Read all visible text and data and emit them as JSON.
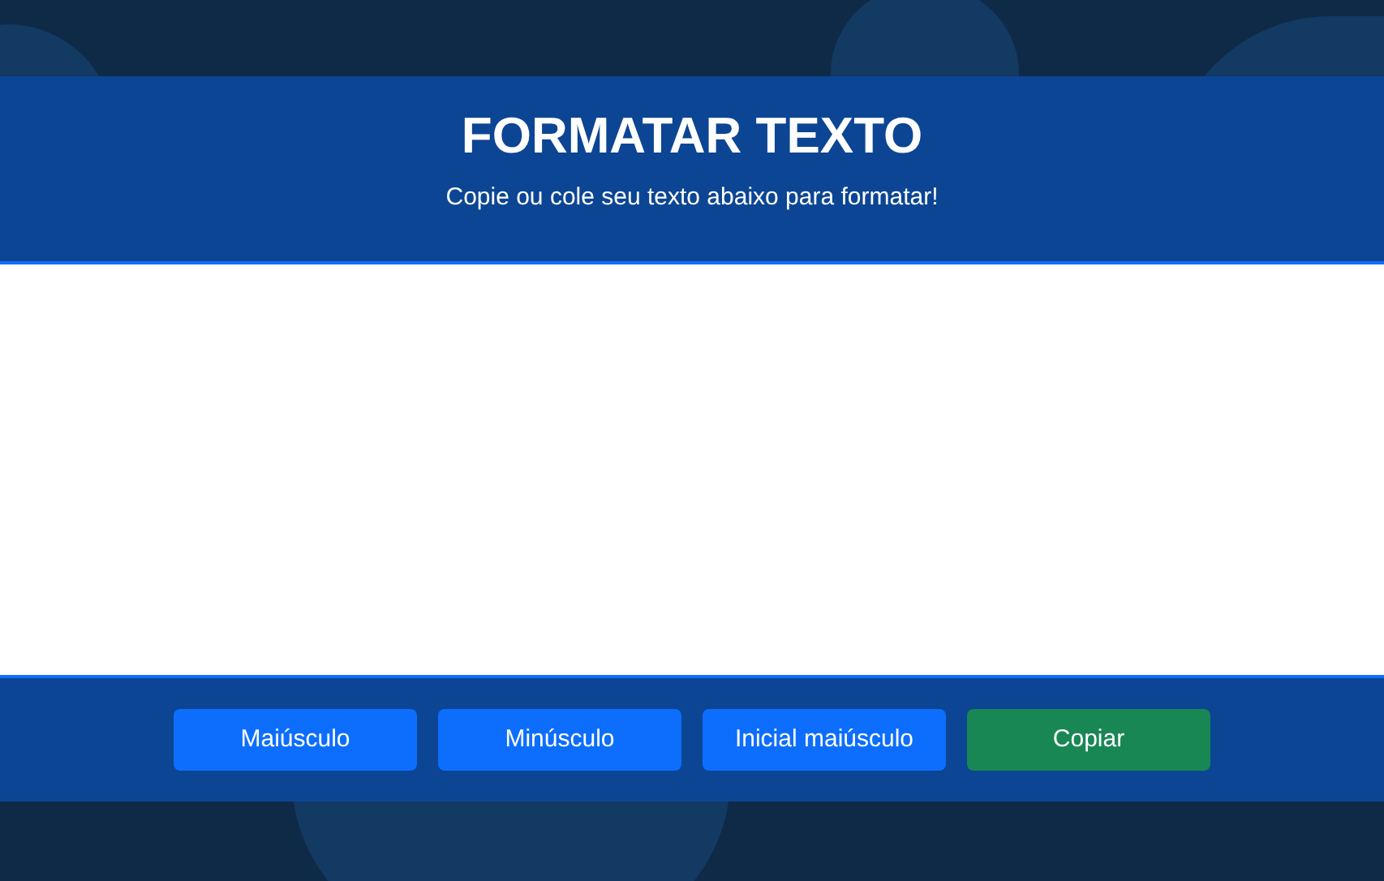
{
  "header": {
    "title": "FORMATAR TEXTO",
    "subtitle": "Copie ou cole seu texto abaixo para formatar!"
  },
  "buttons": [
    {
      "label": "Maiúsculo",
      "kind": "primary"
    },
    {
      "label": "Minúsculo",
      "kind": "primary"
    },
    {
      "label": "Inicial maiúsculo",
      "kind": "primary"
    },
    {
      "label": "Copiar",
      "kind": "success"
    }
  ]
}
